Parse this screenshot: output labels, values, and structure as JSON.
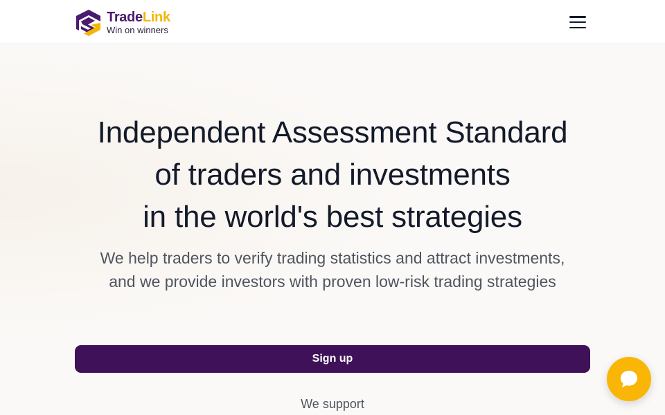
{
  "header": {
    "brand_part1": "Trade",
    "brand_part2": "Link",
    "tagline": "Win on winners",
    "menu_icon": "hamburger-menu-icon"
  },
  "hero": {
    "title_lines": [
      "Independent Assessment Standard",
      "of traders and investments",
      "in the world's best strategies"
    ],
    "subtitle": "We help traders to verify trading statistics and attract investments, and we provide investors with proven low-risk trading strategies",
    "signup_label": "Sign up",
    "support_label": "We support"
  },
  "chat": {
    "icon": "chat-bubble-icon"
  },
  "colors": {
    "brand_purple": "#3f1159",
    "brand_yellow": "#f2b705",
    "chat_yellow": "#f9b606",
    "text_dark": "#131a2a",
    "text_muted": "#4f5560"
  }
}
